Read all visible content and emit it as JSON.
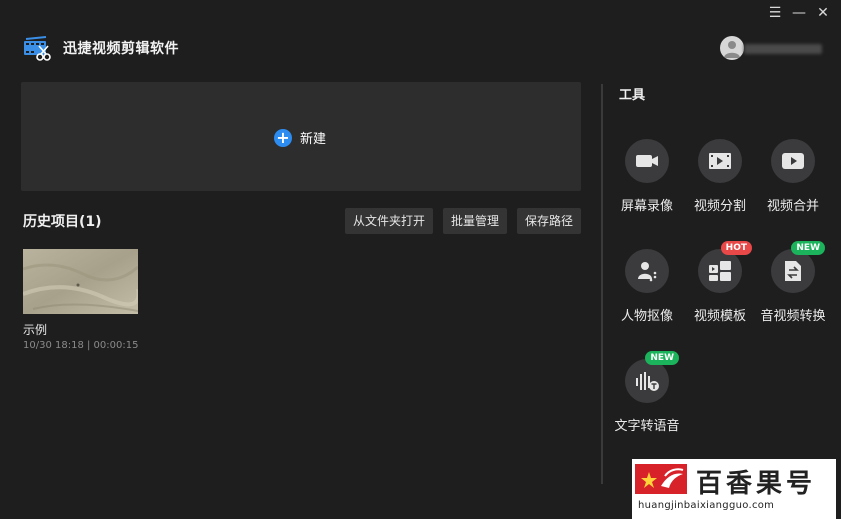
{
  "window": {
    "menu_glyph": "☰",
    "minimize_glyph": "—",
    "close_glyph": "✕"
  },
  "app": {
    "title": "迅捷视频剪辑软件",
    "logo_icon": "film-scissors-icon"
  },
  "user": {
    "avatar_icon": "user-avatar-icon"
  },
  "new_project": {
    "plus": "+",
    "label": "新建",
    "accent": "#2d8cf0"
  },
  "history": {
    "title": "历史项目(1)",
    "buttons": {
      "open_folder": "从文件夹打开",
      "batch_manage": "批量管理",
      "save_path": "保存路径"
    },
    "items": [
      {
        "name": "示例",
        "meta": "10/30 18:18 | 00:00:15"
      }
    ]
  },
  "tools": {
    "title": "工具",
    "items": [
      {
        "label": "屏幕录像",
        "icon": "camera-icon",
        "badge": ""
      },
      {
        "label": "视频分割",
        "icon": "film-split-icon",
        "badge": ""
      },
      {
        "label": "视频合并",
        "icon": "play-icon",
        "badge": ""
      },
      {
        "label": "人物抠像",
        "icon": "person-cutout-icon",
        "badge": ""
      },
      {
        "label": "视频模板",
        "icon": "template-icon",
        "badge": "HOT"
      },
      {
        "label": "音视频转换",
        "icon": "convert-icon",
        "badge": "NEW"
      },
      {
        "label": "文字转语音",
        "icon": "text-to-speech-icon",
        "badge": "NEW"
      }
    ]
  },
  "watermark": {
    "text": "百香果号",
    "url": "huangjinbaixiangguo.com",
    "color": "#d8222a"
  }
}
